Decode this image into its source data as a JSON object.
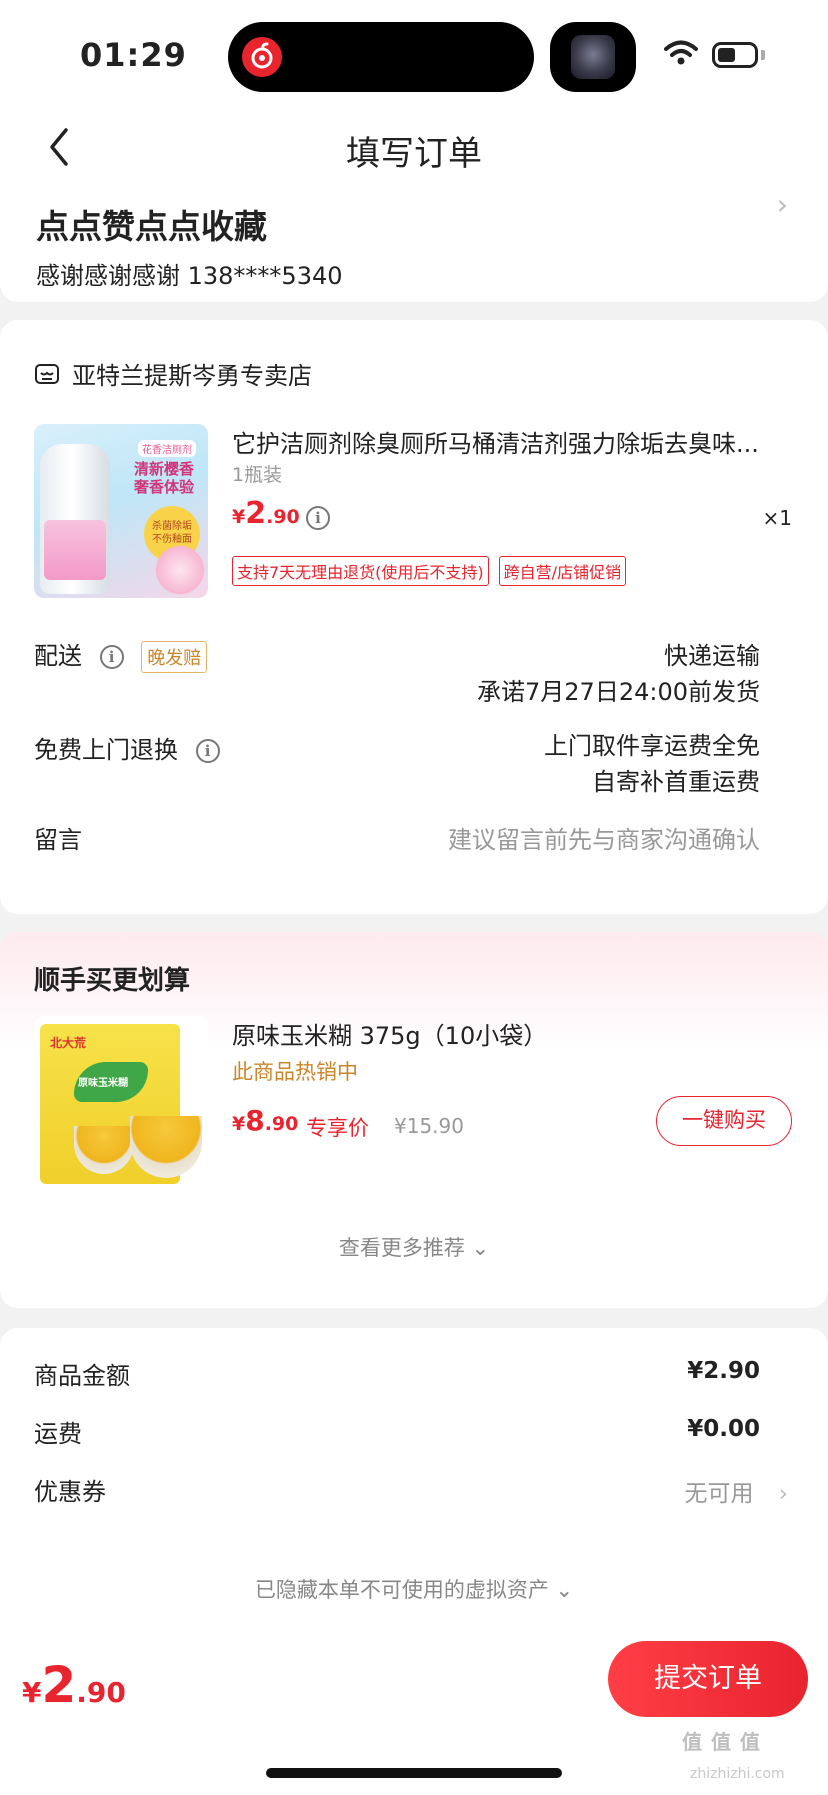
{
  "status_bar": {
    "time": "01:29"
  },
  "nav": {
    "title": "填写订单"
  },
  "address": {
    "name": "点点赞点点收藏",
    "detail": "感谢感谢感谢  138****5340"
  },
  "shop": {
    "name": "亚特兰提斯岑勇专卖店",
    "product": {
      "title": "它护洁厕剂除臭厕所马桶清洁剂强力除垢去臭味...",
      "spec": "1瓶装",
      "price_currency": "¥",
      "price_int": "2",
      "price_dec": ".90",
      "qty": "×1",
      "tags": [
        "支持7天无理由退货(使用后不支持)",
        "跨自营/店铺促销"
      ],
      "image_text": {
        "tag": "花香洁厕剂",
        "headline": "清新樱香\n奢香体验",
        "badge": "杀菌除垢\n不伤釉面"
      }
    },
    "delivery": {
      "label": "配送",
      "badge": "晚发赔",
      "method": "快递运输",
      "promise": "承诺7月27日24:00前发货"
    },
    "returns": {
      "label": "免费上门退换",
      "line1": "上门取件享运费全免",
      "line2": "自寄补首重运费"
    },
    "message": {
      "label": "留言",
      "placeholder": "建议留言前先与商家沟通确认"
    }
  },
  "recommend": {
    "title": "顺手买更划算",
    "item": {
      "name": "原味玉米糊 375g（10小袋）",
      "hot": "此商品热销中",
      "price_currency": "¥",
      "price_int": "8",
      "price_dec": ".90",
      "special_label": "专享价",
      "original_price": "¥15.90",
      "buy_label": "一键购买",
      "image_text": {
        "brand": "北大荒",
        "leaf": "原味玉米糊"
      }
    },
    "more_label": "查看更多推荐 ⌄"
  },
  "summary": {
    "goods_label": "商品金额",
    "goods_value": "¥2.90",
    "shipping_label": "运费",
    "shipping_value": "¥0.00",
    "coupon_label": "优惠券",
    "coupon_value": "无可用",
    "hidden_note": "已隐藏本单不可使用的虚拟资产 ⌄"
  },
  "bottom_bar": {
    "currency": "¥",
    "total_int": "2",
    "total_dec": ".90",
    "submit_label": "提交订单"
  },
  "watermark": {
    "text": "值 值 值",
    "sub": "zhizhizhi.com"
  },
  "colors": {
    "accent": "#e8242f",
    "orange": "#c9862b",
    "background": "#f2f2f2"
  }
}
